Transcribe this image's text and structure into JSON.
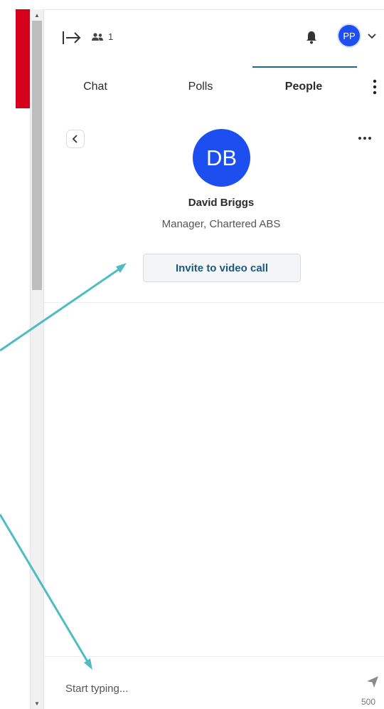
{
  "colors": {
    "accent": "#1a6b8a",
    "avatar_blue": "#1d4ff0",
    "red_tab": "#d6001c",
    "annotation": "#4fbcc4"
  },
  "header": {
    "exit_icon": "exit-panel-icon",
    "participants_icon": "people-icon",
    "participants_count": "1",
    "notification_icon": "bell-icon",
    "user_initials": "PP",
    "user_menu_icon": "chevron-down-icon"
  },
  "tabs": [
    {
      "label": "Chat"
    },
    {
      "label": "Polls"
    },
    {
      "label": "People",
      "active": true
    }
  ],
  "profile": {
    "initials": "DB",
    "name": "David Briggs",
    "role": "Manager, Chartered ABS",
    "invite_label": "Invite to video call"
  },
  "compose": {
    "placeholder": "Start typing...",
    "char_limit": "500"
  }
}
